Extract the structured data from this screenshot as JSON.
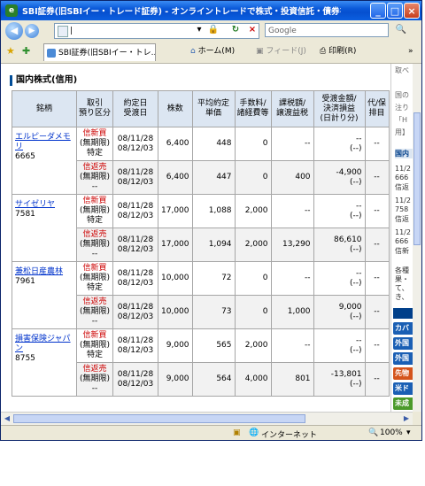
{
  "window": {
    "title": "SBI証券(旧SBIイー・トレード証券) - オンライントレードで株式・投資信託・債券を - - Wind...",
    "app_icon": "e",
    "minimize": "_",
    "maximize": "□",
    "close": "×"
  },
  "address_bar": {
    "back": "◀",
    "forward": "▶",
    "url": "|",
    "dropdown": "▾",
    "lock": "🔒",
    "refresh": "↻",
    "stop": "×",
    "search_placeholder": "Google",
    "search_go": "🔍"
  },
  "tabs": {
    "fav_star": "★",
    "add_fav": "✚",
    "active_tab": "SBI証券(旧SBIイー・トレ...",
    "home_label": "ホーム(M)",
    "feed_label": "フィード(J)",
    "print_label": "印刷(R)",
    "more": "»"
  },
  "section_title": "国内株式(信用)",
  "headers": {
    "name": "銘柄",
    "trade_class": "取引\n預り区分",
    "contract_date": "約定日\n受渡日",
    "qty": "株数",
    "avg_price": "平均約定\n単価",
    "fee": "手数料/\n諸経費等",
    "tax": "課税額/\n譲渡益税",
    "amount": "受渡金額/\n決済損益\n(日計り分)",
    "action": "代/保\n排目"
  },
  "rows": [
    {
      "name": "エルピーダメモリ",
      "code": "6665",
      "kind": "信新買",
      "term": "(無期限)",
      "acct": "特定",
      "date1": "08/11/28",
      "date2": "08/12/03",
      "qty": "6,400",
      "price": "448",
      "fee": "0",
      "tax": "--",
      "amt": "--",
      "amt2": "(--)",
      "act": "--"
    },
    {
      "name": "",
      "code": "",
      "kind": "信返売",
      "term": "(無期限)",
      "acct": "--",
      "date1": "08/11/28",
      "date2": "08/12/03",
      "qty": "6,400",
      "price": "447",
      "fee": "0",
      "tax": "400",
      "amt": "-4,900",
      "amt2": "(--)",
      "act": "--"
    },
    {
      "name": "サイゼリヤ",
      "code": "7581",
      "kind": "信新買",
      "term": "(無期限)",
      "acct": "特定",
      "date1": "08/11/28",
      "date2": "08/12/03",
      "qty": "17,000",
      "price": "1,088",
      "fee": "2,000",
      "tax": "--",
      "amt": "--",
      "amt2": "(--)",
      "act": "--"
    },
    {
      "name": "",
      "code": "",
      "kind": "信返売",
      "term": "(無期限)",
      "acct": "--",
      "date1": "08/11/28",
      "date2": "08/12/03",
      "qty": "17,000",
      "price": "1,094",
      "fee": "2,000",
      "tax": "13,290",
      "amt": "86,610",
      "amt2": "(--)",
      "act": "--"
    },
    {
      "name": "兼松日産農林",
      "code": "7961",
      "kind": "信新買",
      "term": "(無期限)",
      "acct": "特定",
      "date1": "08/11/28",
      "date2": "08/12/03",
      "qty": "10,000",
      "price": "72",
      "fee": "0",
      "tax": "--",
      "amt": "--",
      "amt2": "(--)",
      "act": "--"
    },
    {
      "name": "",
      "code": "",
      "kind": "信返売",
      "term": "(無期限)",
      "acct": "--",
      "date1": "08/11/28",
      "date2": "08/12/03",
      "qty": "10,000",
      "price": "73",
      "fee": "0",
      "tax": "1,000",
      "amt": "9,000",
      "amt2": "(--)",
      "act": "--"
    },
    {
      "name": "損害保険ジャパン",
      "code": "8755",
      "kind": "信新買",
      "term": "(無期限)",
      "acct": "特定",
      "date1": "08/11/28",
      "date2": "08/12/03",
      "qty": "9,000",
      "price": "565",
      "fee": "2,000",
      "tax": "--",
      "amt": "--",
      "amt2": "(--)",
      "act": "--"
    },
    {
      "name": "",
      "code": "",
      "kind": "信返売",
      "term": "(無期限)",
      "acct": "--",
      "date1": "08/11/28",
      "date2": "08/12/03",
      "qty": "9,000",
      "price": "564",
      "fee": "4,000",
      "tax": "801",
      "amt": "-13,801",
      "amt2": "(--)",
      "act": "--"
    }
  ],
  "right_panel": {
    "lines": [
      "取べ",
      "",
      "国の",
      "注り",
      "「H",
      "用】"
    ],
    "list_head": "国内",
    "items": [
      "11/2",
      "666",
      "信返",
      "11/2",
      "758",
      "信返",
      "11/2",
      "666",
      "信新"
    ],
    "notes": [
      "各種",
      "果・",
      "て、",
      "き、"
    ],
    "buttons": [
      "カバ",
      "外国",
      "外国",
      "先物",
      "米ド",
      "未成"
    ]
  },
  "status": {
    "zone": "インターネット",
    "zoom": "100%",
    "zoom_caret": "▾"
  }
}
